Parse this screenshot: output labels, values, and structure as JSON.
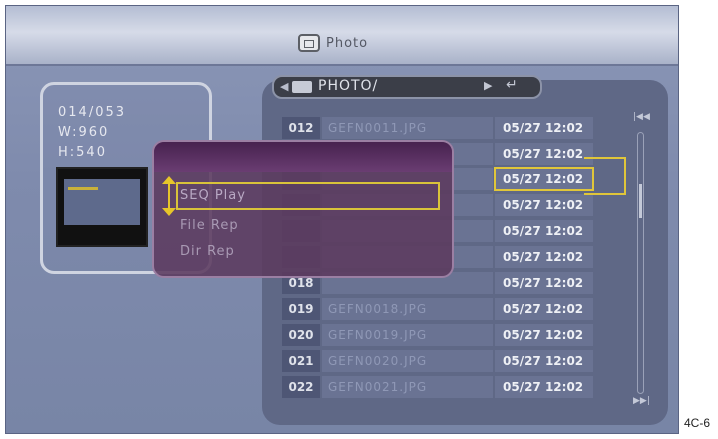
{
  "header": {
    "title": "Photo",
    "icon": "photo-icon"
  },
  "info": {
    "index": "014/053",
    "width": "W:960",
    "height": "H:540"
  },
  "path": {
    "text": "PHOTO/"
  },
  "files": [
    {
      "num": "012",
      "name": "GEFN0011.JPG",
      "date": "05/27 12:02"
    },
    {
      "num": "",
      "name": "",
      "date": "05/27 12:02"
    },
    {
      "num": "",
      "name": "",
      "date": "05/27 12:02"
    },
    {
      "num": "",
      "name": "",
      "date": "05/27 12:02"
    },
    {
      "num": "",
      "name": "",
      "date": "05/27 12:02"
    },
    {
      "num": "",
      "name": "",
      "date": "05/27 12:02"
    },
    {
      "num": "018",
      "name": "",
      "date": "05/27 12:02"
    },
    {
      "num": "019",
      "name": "GEFN0018.JPG",
      "date": "05/27 12:02"
    },
    {
      "num": "020",
      "name": "GEFN0019.JPG",
      "date": "05/27 12:02"
    },
    {
      "num": "021",
      "name": "GEFN0020.JPG",
      "date": "05/27 12:02"
    },
    {
      "num": "022",
      "name": "GEFN0021.JPG",
      "date": "05/27 12:02"
    }
  ],
  "popup": {
    "items": [
      "SEQ Play",
      "File Rep",
      "Dir Rep"
    ],
    "selected": 0
  },
  "colors": {
    "highlight": "#e0c63a",
    "popup_bg": "#5c3a5f"
  },
  "label": "4C-6"
}
